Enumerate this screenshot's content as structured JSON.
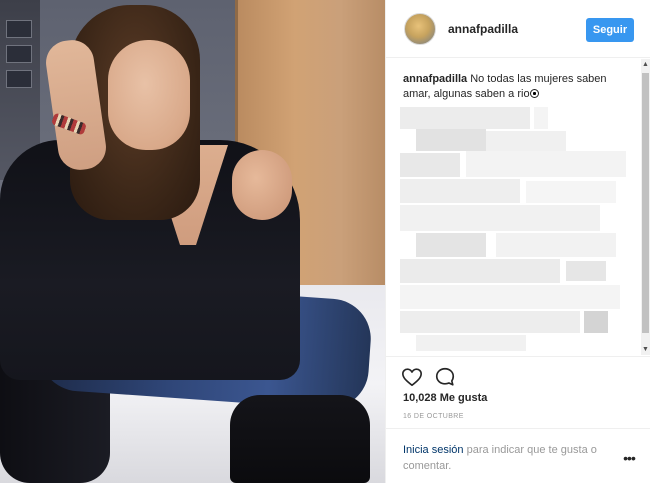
{
  "post": {
    "username": "annafpadilla",
    "follow_label": "Seguir",
    "caption": {
      "username": "annafpadilla",
      "text": "No todas las mujeres saben amar, algunas saben a rio"
    },
    "likes_text": "10,028 Me gusta",
    "date": "16 DE OCTUBRE"
  },
  "footer": {
    "login_link": "Inicia sesión",
    "login_rest": " para indicar que te gusta o comentar.",
    "more_label": "•••"
  },
  "icons": {
    "like": "heart-icon",
    "comment": "comment-icon",
    "more": "more-dots-icon"
  },
  "colors": {
    "follow_button": "#3897f0",
    "link": "#003569",
    "muted_text": "#999999",
    "text": "#262626"
  }
}
